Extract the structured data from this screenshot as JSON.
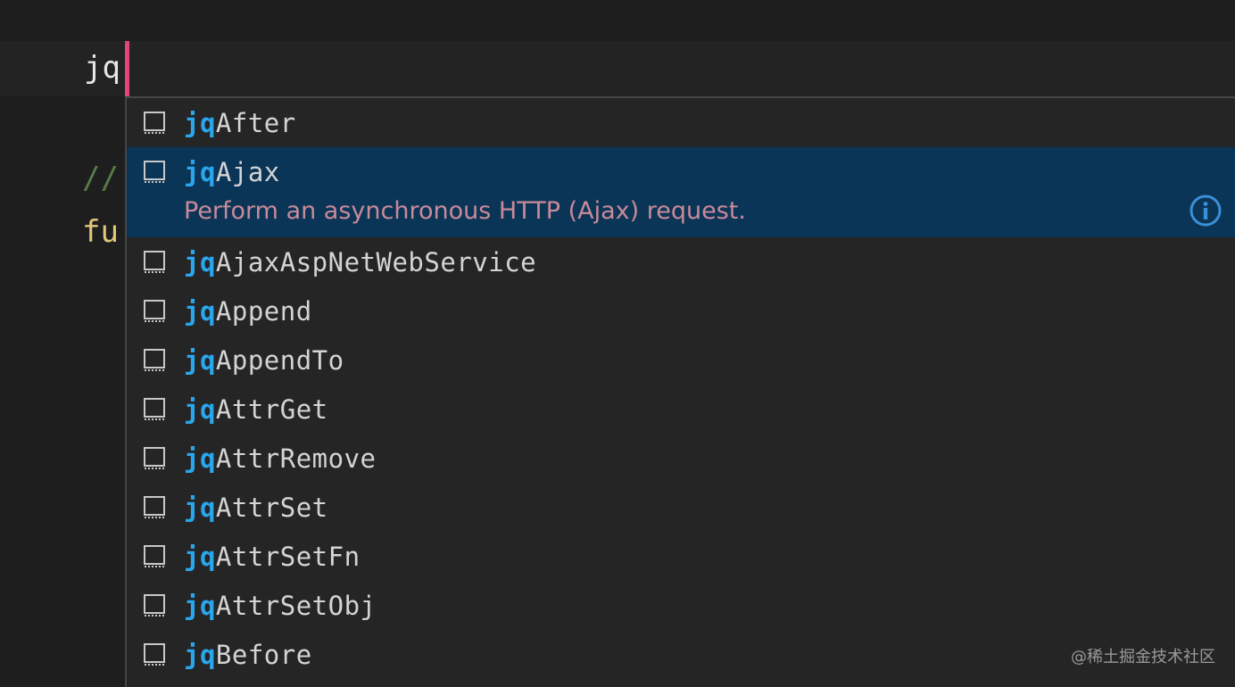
{
  "editor": {
    "typed_text": "jq",
    "partial_line_comment": "//",
    "partial_line_keyword": "fu"
  },
  "suggestions": {
    "match_prefix": "jq",
    "selected_index": 1,
    "items": [
      {
        "prefix": "jq",
        "rest": "After",
        "icon": "snippet-icon"
      },
      {
        "prefix": "jq",
        "rest": "Ajax",
        "icon": "snippet-icon",
        "detail": "Perform an asynchronous HTTP (Ajax) request."
      },
      {
        "prefix": "jq",
        "rest": "AjaxAspNetWebService",
        "icon": "snippet-icon"
      },
      {
        "prefix": "jq",
        "rest": "Append",
        "icon": "snippet-icon"
      },
      {
        "prefix": "jq",
        "rest": "AppendTo",
        "icon": "snippet-icon"
      },
      {
        "prefix": "jq",
        "rest": "AttrGet",
        "icon": "snippet-icon"
      },
      {
        "prefix": "jq",
        "rest": "AttrRemove",
        "icon": "snippet-icon"
      },
      {
        "prefix": "jq",
        "rest": "AttrSet",
        "icon": "snippet-icon"
      },
      {
        "prefix": "jq",
        "rest": "AttrSetFn",
        "icon": "snippet-icon"
      },
      {
        "prefix": "jq",
        "rest": "AttrSetObj",
        "icon": "snippet-icon"
      },
      {
        "prefix": "jq",
        "rest": "Before",
        "icon": "snippet-icon"
      }
    ]
  },
  "colors": {
    "background": "#1e1e1e",
    "widget_background": "#252526",
    "selected_row": "#0b3557",
    "match_highlight": "#2aa6ec",
    "cursor": "#e2457c",
    "detail_text": "#c98a9a"
  },
  "watermark": "@稀土掘金技术社区"
}
